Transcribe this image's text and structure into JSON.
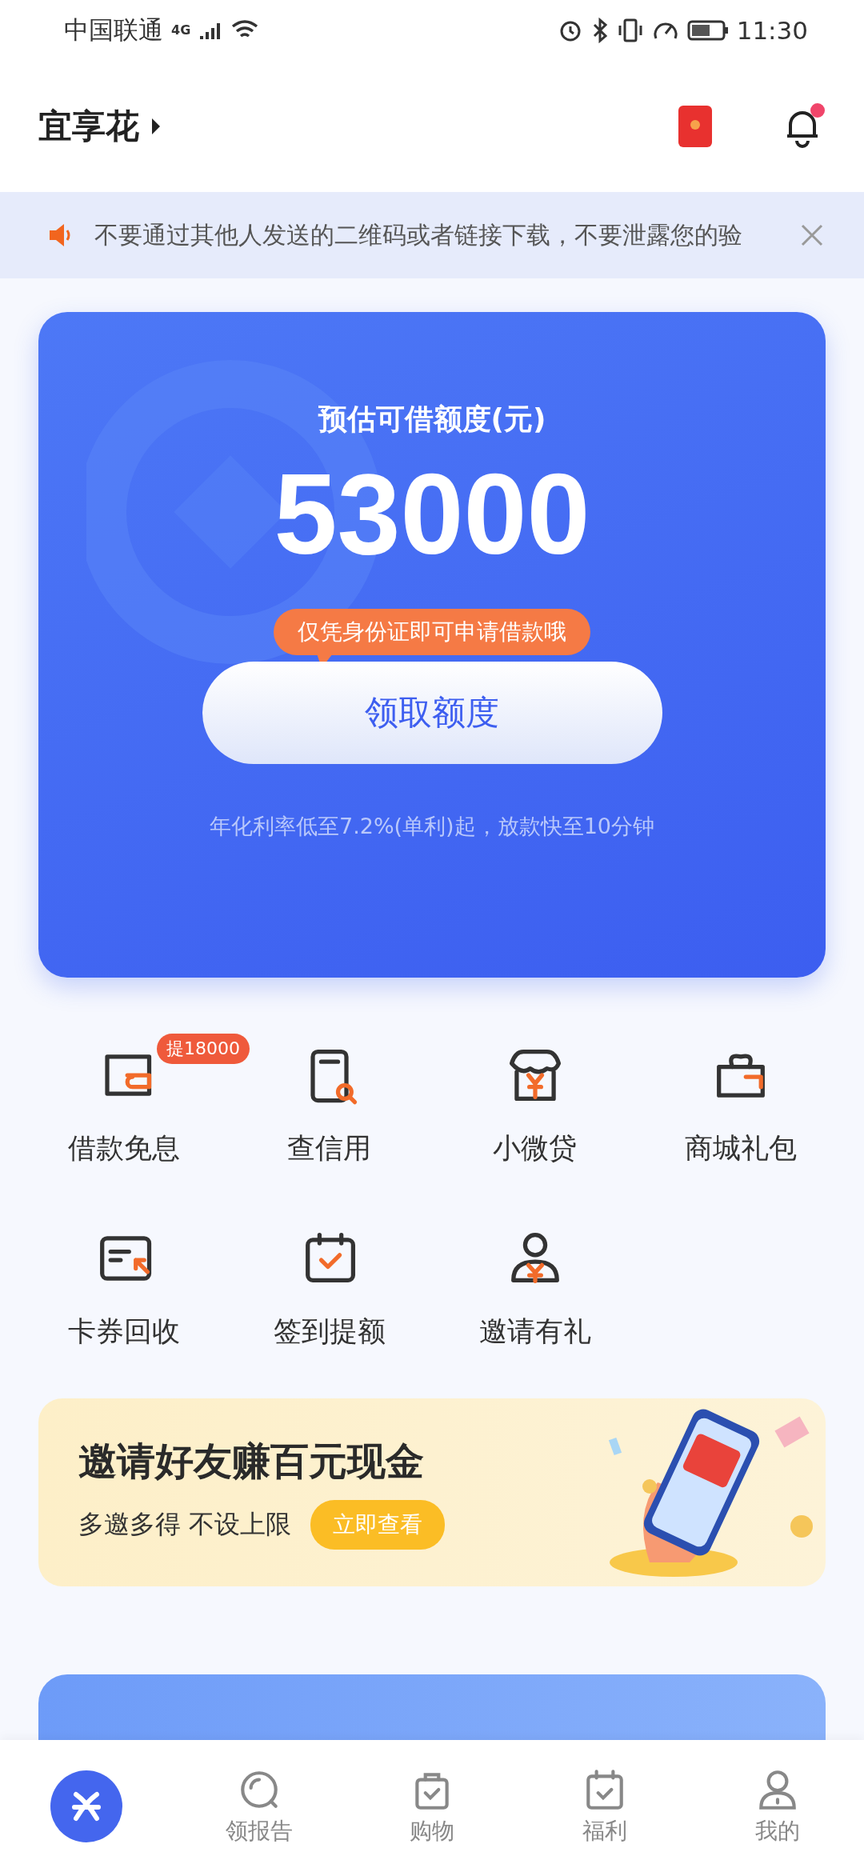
{
  "status_bar": {
    "carrier": "中国联通",
    "network": "4G",
    "time": "11:30"
  },
  "header": {
    "title": "宜享花",
    "has_notification": true
  },
  "notice": {
    "text": "不要通过其他人发送的二维码或者链接下载，不要泄露您的验"
  },
  "credit_card": {
    "title": "预估可借额度(元)",
    "amount": "53000",
    "tip": "仅凭身份证即可申请借款哦",
    "button": "领取额度",
    "footnote": "年化利率低至7.2%(单利)起，放款快至10分钟"
  },
  "services": [
    {
      "kind": "wallet",
      "label": "借款免息",
      "badge": "提18000"
    },
    {
      "kind": "report",
      "label": "查信用"
    },
    {
      "kind": "shop",
      "label": "小微贷"
    },
    {
      "kind": "gift",
      "label": "商城礼包"
    },
    {
      "kind": "card",
      "label": "卡券回收"
    },
    {
      "kind": "calendar",
      "label": "签到提额"
    },
    {
      "kind": "person",
      "label": "邀请有礼"
    }
  ],
  "promo": {
    "title": "邀请好友赚百元现金",
    "subtitle": "多邀多得 不设上限",
    "button": "立即查看",
    "kind": "picture"
  },
  "bottom_nav": [
    {
      "kind": "logo",
      "selected": true
    },
    {
      "kind": "report",
      "label": "领报告",
      "selected": false
    },
    {
      "kind": "bag",
      "label": "购物",
      "selected": false
    },
    {
      "kind": "calendar",
      "label": "福利",
      "selected": false
    },
    {
      "kind": "person",
      "label": "我的",
      "selected": false
    }
  ]
}
